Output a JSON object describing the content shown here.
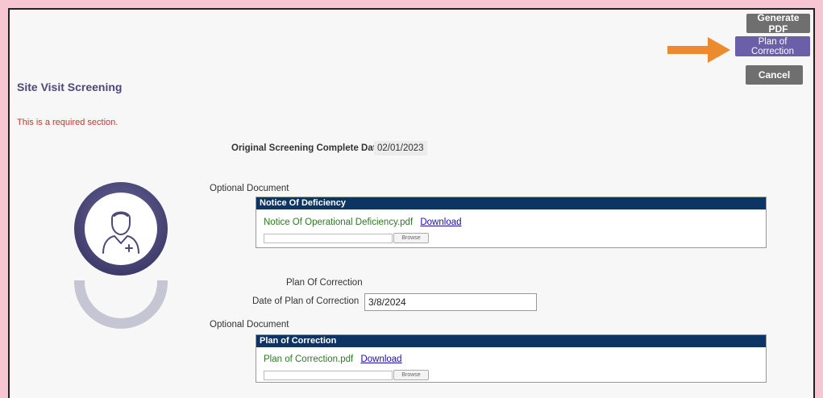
{
  "toolbar": {
    "generate_pdf_label": "Generate PDF",
    "plan_label": "Plan of Correction",
    "cancel_label": "Cancel"
  },
  "page": {
    "title": "Site Visit Screening",
    "required_text": "This is a required section."
  },
  "screening": {
    "label": "Original Screening Complete Date",
    "date": "02/01/2023"
  },
  "optional_document_1": {
    "label": "Optional Document",
    "header": "Notice Of Deficiency",
    "file_name": "Notice Of Operational Deficiency.pdf",
    "download_label": "Download",
    "browse_label": "Browse"
  },
  "plan_section": {
    "heading": "Plan Of Correction",
    "date_label": "Date of Plan of Correction",
    "date_value": "3/8/2024"
  },
  "optional_document_2": {
    "label": "Optional Document",
    "header": "Plan of Correction",
    "file_name": "Plan of Correction.pdf",
    "download_label": "Download",
    "browse_label": "Browse"
  },
  "colors": {
    "page_background": "#f8c6d2",
    "arrow": "#ec8a2e",
    "title": "#4d4876",
    "required": "#c0392b",
    "doc_header": "#0d3462",
    "file_name": "#2c7a22",
    "plan_button": "#6a5fa8"
  },
  "icons": {
    "avatar": "user-plus-icon",
    "arrow": "arrow-right-icon"
  }
}
